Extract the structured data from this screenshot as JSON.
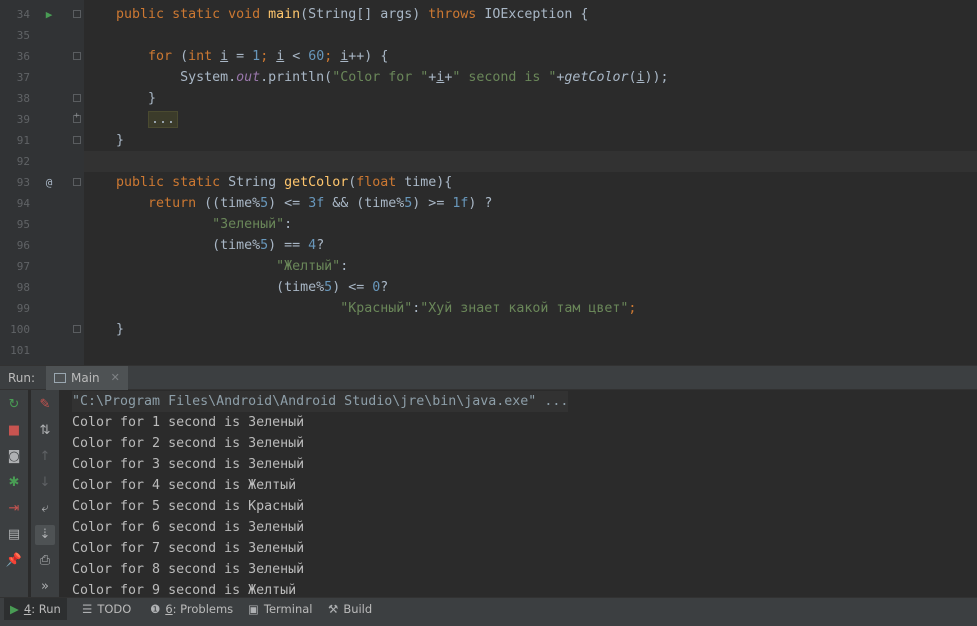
{
  "colors": {
    "keyword": "#cc7832",
    "function": "#ffc66d",
    "string": "#6a8759",
    "number": "#6897bb",
    "field": "#9876aa",
    "plain": "#a9b7c6"
  },
  "editor": {
    "lines": [
      {
        "n": "34",
        "gutter_icon": "run-arrow-icon",
        "fold": "minus",
        "current": false,
        "tokens": [
          {
            "t": "    ",
            "c": ""
          },
          {
            "t": "public static void ",
            "c": "kw"
          },
          {
            "t": "main",
            "c": "fn"
          },
          {
            "t": "(String[] args) ",
            "c": ""
          },
          {
            "t": "throws ",
            "c": "kw"
          },
          {
            "t": "IOException {",
            "c": ""
          }
        ]
      },
      {
        "n": "35",
        "gutter_icon": "",
        "fold": "",
        "current": false,
        "tokens": []
      },
      {
        "n": "36",
        "gutter_icon": "",
        "fold": "minus",
        "current": false,
        "tokens": [
          {
            "t": "        ",
            "c": ""
          },
          {
            "t": "for ",
            "c": "kw"
          },
          {
            "t": "(",
            "c": ""
          },
          {
            "t": "int ",
            "c": "kw"
          },
          {
            "t": "i",
            "c": "ul"
          },
          {
            "t": " = ",
            "c": ""
          },
          {
            "t": "1",
            "c": "num"
          },
          {
            "t": "; ",
            "c": "kw"
          },
          {
            "t": "i",
            "c": "ul"
          },
          {
            "t": " < ",
            "c": ""
          },
          {
            "t": "60",
            "c": "num"
          },
          {
            "t": "; ",
            "c": "kw"
          },
          {
            "t": "i",
            "c": "ul"
          },
          {
            "t": "++) {",
            "c": ""
          }
        ]
      },
      {
        "n": "37",
        "gutter_icon": "",
        "fold": "",
        "current": false,
        "tokens": [
          {
            "t": "            System.",
            "c": ""
          },
          {
            "t": "out",
            "c": "it"
          },
          {
            "t": ".println(",
            "c": ""
          },
          {
            "t": "\"Color for \"",
            "c": "str"
          },
          {
            "t": "+",
            "c": ""
          },
          {
            "t": "i",
            "c": "ul"
          },
          {
            "t": "+",
            "c": ""
          },
          {
            "t": "\" second is \"",
            "c": "str"
          },
          {
            "t": "+",
            "c": ""
          },
          {
            "t": "getColor",
            "c": "fnit"
          },
          {
            "t": "(",
            "c": ""
          },
          {
            "t": "i",
            "c": "ul"
          },
          {
            "t": "));",
            "c": ""
          }
        ]
      },
      {
        "n": "38",
        "gutter_icon": "",
        "fold": "minus",
        "current": false,
        "tokens": [
          {
            "t": "        }",
            "c": ""
          }
        ]
      },
      {
        "n": "39",
        "gutter_icon": "",
        "fold": "plus",
        "current": false,
        "tokens": [
          {
            "t": "        ",
            "c": ""
          },
          {
            "t": "...",
            "c": "folded"
          }
        ]
      },
      {
        "n": "91",
        "gutter_icon": "",
        "fold": "minus",
        "current": false,
        "tokens": [
          {
            "t": "    }",
            "c": ""
          }
        ]
      },
      {
        "n": "92",
        "gutter_icon": "",
        "fold": "",
        "current": true,
        "tokens": []
      },
      {
        "n": "93",
        "gutter_icon": "override-at-icon",
        "fold": "minus",
        "current": false,
        "tokens": [
          {
            "t": "    ",
            "c": ""
          },
          {
            "t": "public static ",
            "c": "kw"
          },
          {
            "t": "String ",
            "c": ""
          },
          {
            "t": "getColor",
            "c": "fn"
          },
          {
            "t": "(",
            "c": ""
          },
          {
            "t": "float ",
            "c": "kw"
          },
          {
            "t": "time){",
            "c": ""
          }
        ]
      },
      {
        "n": "94",
        "gutter_icon": "",
        "fold": "",
        "current": false,
        "tokens": [
          {
            "t": "        ",
            "c": ""
          },
          {
            "t": "return ",
            "c": "kw"
          },
          {
            "t": "((time%",
            "c": ""
          },
          {
            "t": "5",
            "c": "num"
          },
          {
            "t": ") <= ",
            "c": ""
          },
          {
            "t": "3f ",
            "c": "num"
          },
          {
            "t": "&& (time%",
            "c": ""
          },
          {
            "t": "5",
            "c": "num"
          },
          {
            "t": ") >= ",
            "c": ""
          },
          {
            "t": "1f",
            "c": "num"
          },
          {
            "t": ") ?",
            "c": ""
          }
        ]
      },
      {
        "n": "95",
        "gutter_icon": "",
        "fold": "",
        "current": false,
        "tokens": [
          {
            "t": "                ",
            "c": ""
          },
          {
            "t": "\"Зеленый\"",
            "c": "str"
          },
          {
            "t": ":",
            "c": ""
          }
        ]
      },
      {
        "n": "96",
        "gutter_icon": "",
        "fold": "",
        "current": false,
        "tokens": [
          {
            "t": "                (time%",
            "c": ""
          },
          {
            "t": "5",
            "c": "num"
          },
          {
            "t": ") == ",
            "c": ""
          },
          {
            "t": "4",
            "c": "num"
          },
          {
            "t": "?",
            "c": ""
          }
        ]
      },
      {
        "n": "97",
        "gutter_icon": "",
        "fold": "",
        "current": false,
        "tokens": [
          {
            "t": "                        ",
            "c": ""
          },
          {
            "t": "\"Желтый\"",
            "c": "str"
          },
          {
            "t": ":",
            "c": ""
          }
        ]
      },
      {
        "n": "98",
        "gutter_icon": "",
        "fold": "",
        "current": false,
        "tokens": [
          {
            "t": "                        (time%",
            "c": ""
          },
          {
            "t": "5",
            "c": "num"
          },
          {
            "t": ") <= ",
            "c": ""
          },
          {
            "t": "0",
            "c": "num"
          },
          {
            "t": "?",
            "c": ""
          }
        ]
      },
      {
        "n": "99",
        "gutter_icon": "",
        "fold": "",
        "current": false,
        "tokens": [
          {
            "t": "                                ",
            "c": ""
          },
          {
            "t": "\"Красный\"",
            "c": "str"
          },
          {
            "t": ":",
            "c": ""
          },
          {
            "t": "\"Хуй знает какой там цвет\"",
            "c": "str"
          },
          {
            "t": ";",
            "c": "kw"
          }
        ]
      },
      {
        "n": "100",
        "gutter_icon": "",
        "fold": "minus",
        "current": false,
        "tokens": [
          {
            "t": "    }",
            "c": ""
          }
        ]
      },
      {
        "n": "101",
        "gutter_icon": "",
        "fold": "",
        "current": false,
        "tokens": []
      }
    ]
  },
  "run_panel": {
    "label": "Run:",
    "tab_icon": "console-tab-icon",
    "tab_label": "Main",
    "close_glyph": "✕",
    "left_tools": [
      {
        "name": "rerun-icon",
        "glyph": "↻",
        "color": "#499c54"
      },
      {
        "name": "stop-icon",
        "glyph": "■",
        "color": "#c75450"
      },
      {
        "name": "camera-icon",
        "glyph": "◙",
        "color": "#afb1b3"
      },
      {
        "name": "debug-bug-icon",
        "glyph": "✱",
        "color": "#499c54"
      },
      {
        "name": "exit-icon",
        "glyph": "⇥",
        "color": "#c75450"
      },
      {
        "name": "layout-icon",
        "glyph": "▤",
        "color": "#afb1b3"
      },
      {
        "name": "pin-icon",
        "glyph": "📌",
        "color": "#afb1b3"
      }
    ],
    "right_tools": [
      {
        "name": "clear-console-icon",
        "glyph": "✎",
        "color": "#c75450",
        "active": false
      },
      {
        "name": "sort-icon",
        "glyph": "⇅",
        "color": "#afb1b3",
        "active": false
      },
      {
        "name": "up-arrow-icon",
        "glyph": "↑",
        "color": "#5f6265",
        "active": false
      },
      {
        "name": "down-arrow-icon",
        "glyph": "↓",
        "color": "#5f6265",
        "active": false
      },
      {
        "name": "soft-wrap-icon",
        "glyph": "⤶",
        "color": "#afb1b3",
        "active": false
      },
      {
        "name": "scroll-to-end-icon",
        "glyph": "⇣",
        "color": "#afb1b3",
        "active": true
      },
      {
        "name": "print-icon",
        "glyph": "⎙",
        "color": "#afb1b3",
        "active": false
      },
      {
        "name": "more-icon",
        "glyph": "»",
        "color": "#afb1b3",
        "active": false
      }
    ],
    "console_lines": [
      "\"C:\\Program Files\\Android\\Android Studio\\jre\\bin\\java.exe\" ...",
      "Color for 1 second is Зеленый",
      "Color for 2 second is Зеленый",
      "Color for 3 second is Зеленый",
      "Color for 4 second is Желтый",
      "Color for 5 second is Красный",
      "Color for 6 second is Зеленый",
      "Color for 7 second is Зеленый",
      "Color for 8 second is Зеленый",
      "Color for 9 second is Желтый"
    ]
  },
  "status_bar": {
    "tabs": [
      {
        "name": "run",
        "icon": "run-icon",
        "glyph": "▶",
        "num": "4",
        "label": ": Run",
        "active": true
      },
      {
        "name": "todo",
        "icon": "todo-list-icon",
        "glyph": "☰",
        "num": "",
        "label": "TODO",
        "active": false
      },
      {
        "name": "problems",
        "icon": "problems-icon",
        "glyph": "❶",
        "num": "6",
        "label": ": Problems",
        "active": false
      },
      {
        "name": "terminal",
        "icon": "terminal-icon",
        "glyph": "▣",
        "num": "",
        "label": "Terminal",
        "active": false
      },
      {
        "name": "build",
        "icon": "build-hammer-icon",
        "glyph": "⚒",
        "num": "",
        "label": "Build",
        "active": false
      }
    ]
  }
}
